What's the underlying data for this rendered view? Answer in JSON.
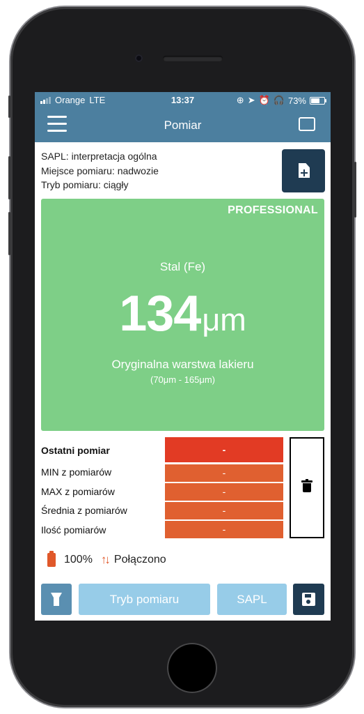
{
  "status_bar": {
    "carrier": "Orange",
    "network": "LTE",
    "time": "13:37",
    "battery_percent": "73%",
    "battery_level": 0.73,
    "signal_bars_active": 2,
    "icons": [
      "lock-rotation-icon",
      "location-icon",
      "alarm-icon",
      "headphones-icon"
    ]
  },
  "navbar": {
    "title": "Pomiar",
    "menu_icon": "hamburger-icon",
    "scan_icon": "fullscreen-icon"
  },
  "info": {
    "sapl": "SAPL: interpretacja ogólna",
    "location": "Miejsce pomiaru: nadwozie",
    "mode": "Tryb pomiaru: ciągły",
    "report_icon": "add-document-icon"
  },
  "measurement": {
    "badge": "PROFESSIONAL",
    "material": "Stal (Fe)",
    "value": "134",
    "unit": "μm",
    "status": "Oryginalna warstwa lakieru",
    "range": "(70μm - 165μm)",
    "panel_color": "#7ecf87"
  },
  "stats": {
    "last_label": "Ostatni pomiar",
    "last_value": "-",
    "min_label": "MIN z pomiarów",
    "min_value": "-",
    "max_label": "MAX z pomiarów",
    "max_value": "-",
    "avg_label": "Średnia z pomiarów",
    "avg_value": "-",
    "count_label": "Ilość pomiarów",
    "count_value": "-",
    "last_color": "#e23b24",
    "other_color": "#e06030",
    "delete_icon": "trash-icon"
  },
  "device": {
    "battery": "100%",
    "connection": "Połączono",
    "battery_icon": "battery-icon",
    "connection_icon": "transfer-arrows-icon",
    "accent": "#e0582a"
  },
  "bottom_bar": {
    "mode_button": "Tryb pomiaru",
    "sapl_button": "SAPL",
    "light_icon": "flashlight-icon",
    "save_icon": "save-icon"
  },
  "colors": {
    "header": "#4c7f9f",
    "dark_button": "#1f3b52",
    "light_button": "#97cce8"
  }
}
